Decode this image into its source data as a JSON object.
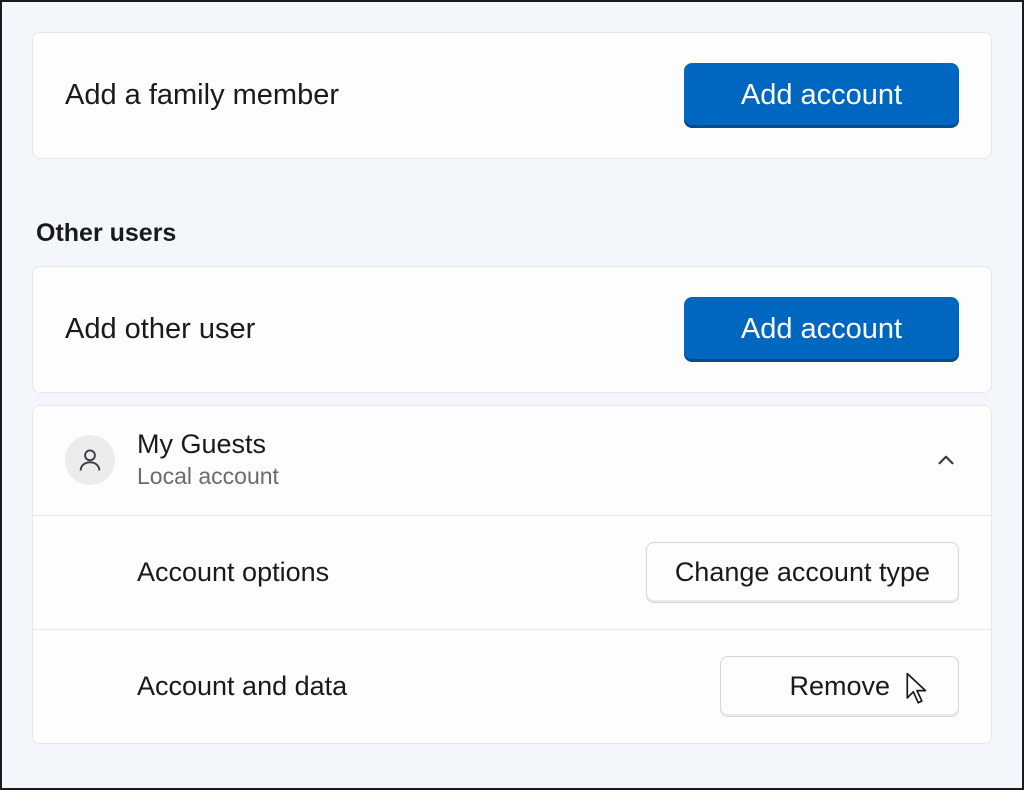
{
  "family": {
    "label": "Add a family member",
    "button": "Add account"
  },
  "other_section_title": "Other users",
  "other": {
    "label": "Add other user",
    "button": "Add account"
  },
  "user": {
    "name": "My Guests",
    "type": "Local account",
    "options_label": "Account options",
    "options_button": "Change account type",
    "data_label": "Account and data",
    "data_button": "Remove"
  }
}
